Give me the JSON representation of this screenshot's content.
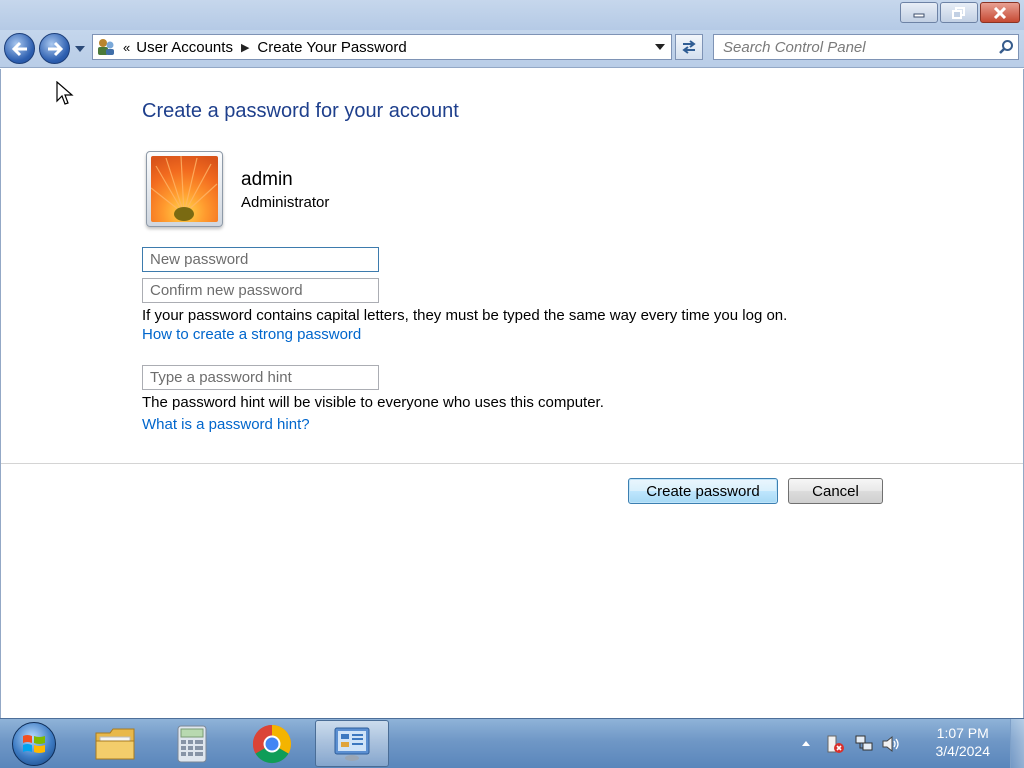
{
  "window": {
    "minimize_icon": "minimize-icon",
    "restore_icon": "restore-icon",
    "close_icon": "close-icon"
  },
  "navbar": {
    "back_icon": "back-arrow-icon",
    "forward_icon": "forward-arrow-icon",
    "chevron": "«",
    "breadcrumb": [
      "User Accounts",
      "Create Your Password"
    ],
    "breadcrumb_separator": "▶",
    "search_placeholder": "Search Control Panel"
  },
  "content": {
    "heading": "Create a password for your account",
    "user": {
      "name": "admin",
      "role": "Administrator"
    },
    "fields": {
      "new_password_placeholder": "New password",
      "confirm_password_placeholder": "Confirm new password",
      "hint_placeholder": "Type a password hint"
    },
    "caps_info": "If your password contains capital letters, they must be typed the same way every time you log on.",
    "strong_password_link": "How to create a strong password",
    "hint_info": "The password hint will be visible to everyone who uses this computer.",
    "hint_link": "What is a password hint?",
    "buttons": {
      "create": "Create password",
      "cancel": "Cancel"
    }
  },
  "taskbar": {
    "items": [
      "windows-explorer",
      "calculator",
      "google-chrome",
      "control-panel"
    ],
    "active_item": "control-panel",
    "clock": {
      "time": "1:07 PM",
      "date": "3/4/2024"
    }
  },
  "colors": {
    "heading": "#1e3f8c",
    "link": "#0066cc",
    "titlebar": "#b9cde7"
  }
}
